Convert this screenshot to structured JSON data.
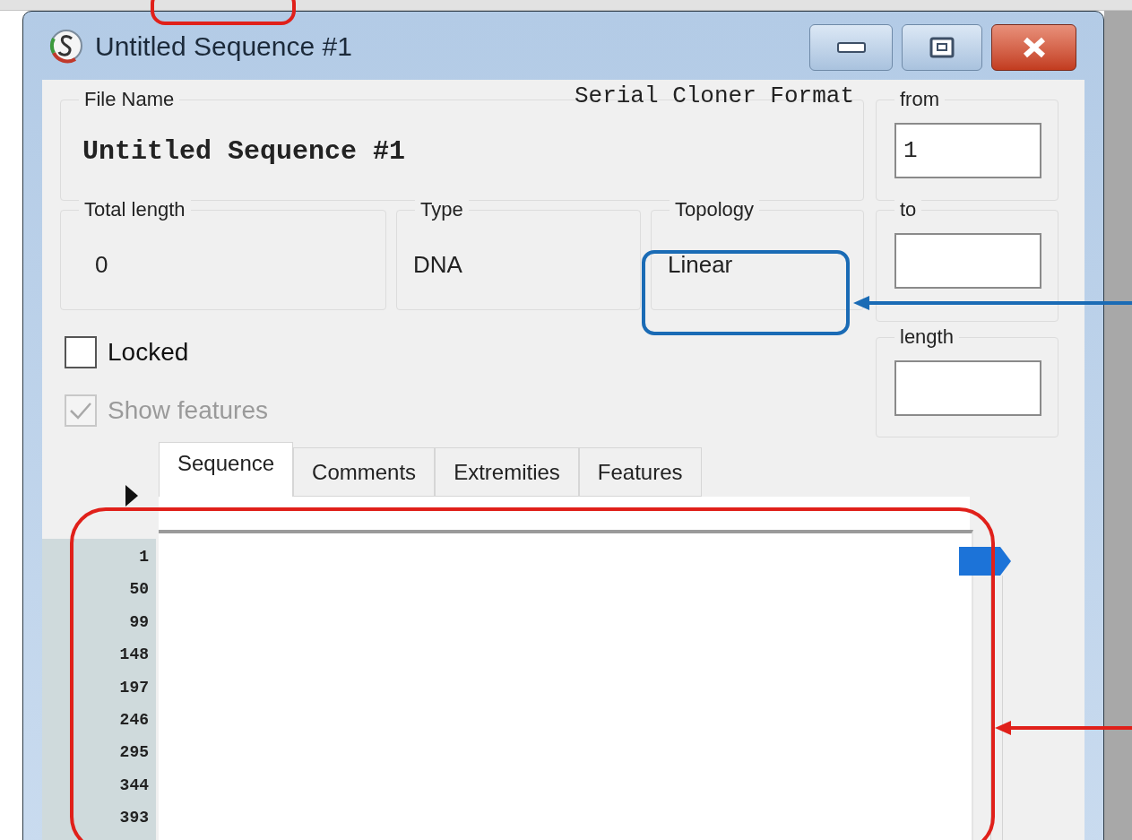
{
  "window": {
    "title": "Untitled Sequence #1"
  },
  "format_label": "Serial Cloner Format",
  "file_name": {
    "label": "File Name",
    "value": "Untitled Sequence #1"
  },
  "info": [
    {
      "label": "Total length",
      "value": "0"
    },
    {
      "label": "Type",
      "value": "DNA"
    },
    {
      "label": "Topology",
      "value": "Linear"
    }
  ],
  "range": [
    {
      "label": "from",
      "value": "1"
    },
    {
      "label": "to"
    },
    {
      "label": "length"
    }
  ],
  "checkboxes": [
    {
      "label": "Locked",
      "checked": false,
      "disabled": false
    },
    {
      "label": "Show features",
      "checked": true,
      "disabled": true
    }
  ],
  "tabs": [
    {
      "label": "Sequence",
      "selected": true
    },
    {
      "label": "Comments",
      "selected": false
    },
    {
      "label": "Extremities",
      "selected": false
    },
    {
      "label": "Features",
      "selected": false
    }
  ],
  "line_numbers": [
    "1",
    "50",
    "99",
    "148",
    "197",
    "246",
    "295",
    "344",
    "393"
  ]
}
